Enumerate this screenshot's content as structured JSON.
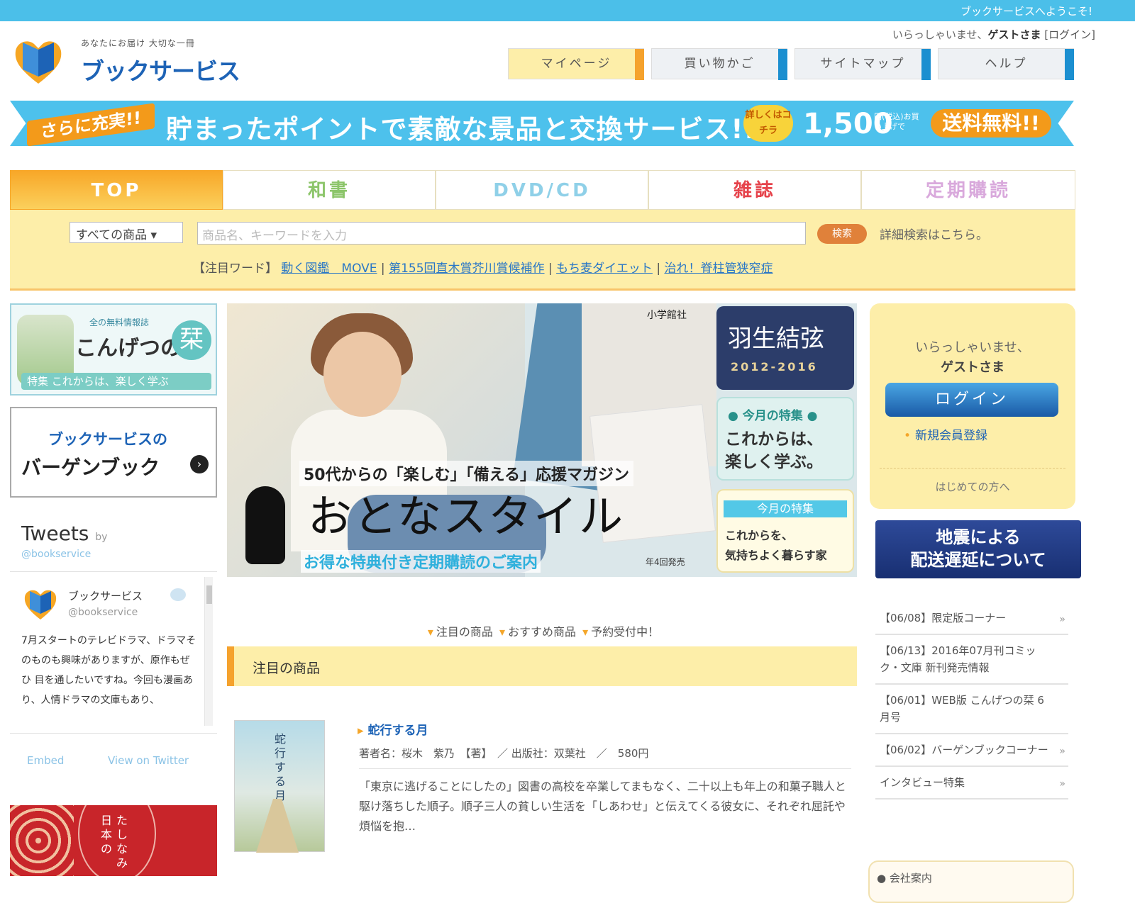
{
  "topbar": {
    "welcome": "ブックサービスへようこそ!"
  },
  "logo": {
    "tagline": "あなたにお届け 大切な一冊",
    "name": "ブックサービス"
  },
  "header": {
    "greeting": "いらっしゃいませ、",
    "guest": "ゲストさま",
    "login_link": "[ログイン]"
  },
  "nav": [
    {
      "label": "マイページ",
      "bg": "#fdeea9",
      "accent": "#f5a22d"
    },
    {
      "label": "買い物かご",
      "bg": "#eef1f4",
      "accent": "#1b8fd0"
    },
    {
      "label": "サイトマップ",
      "bg": "#eef1f4",
      "accent": "#1b8fd0"
    },
    {
      "label": "ヘルプ",
      "bg": "#eef1f4",
      "accent": "#1b8fd0"
    }
  ],
  "banner": {
    "left": "さらに充実!!",
    "main": "貯まったポイントで素敵な景品と交換サービス!!",
    "badge": "詳しくはコチラ",
    "price": "1,500",
    "price_note": "円(税込)お買い上げで",
    "free": "送料無料!!"
  },
  "tabs": [
    {
      "label": "TOP",
      "color": "#ffffff"
    },
    {
      "label": "和書",
      "color": "#8cc56a"
    },
    {
      "label": "DVD/CD",
      "color": "#8fd0e8"
    },
    {
      "label": "雑誌",
      "color": "#e6434b"
    },
    {
      "label": "定期購読",
      "color": "#d9a9dc"
    }
  ],
  "search": {
    "category": "すべての商品",
    "placeholder": "商品名、キーワードを入力",
    "button": "検索",
    "advanced": "詳細検索はこちら。",
    "hot_label": "【注目ワード】",
    "hot_words": [
      "動く図鑑　MOVE",
      "第155回直木賞芥川賞候補作",
      "もち麦ダイエット",
      "治れ！脊柱管狭窄症"
    ]
  },
  "left": {
    "konpan": {
      "top": "全の無料情報誌",
      "name": "こんげつの",
      "char": "栞",
      "strip": "特集 これからは、楽しく学ぶ"
    },
    "bargain": {
      "line1": "ブックサービスの",
      "line2": "バーゲンブック"
    },
    "tweets": {
      "title": "Tweets",
      "by": "by",
      "handle": "@bookservice",
      "user_name": "ブックサービス",
      "user_handle": "@bookservice",
      "text": "7月スタートのテレビドラマ、ドラマそのものも興味がありますが、原作もぜひ 目を通したいですね。今回も漫画あり、人情ドラマの文庫もあり、",
      "embed": "Embed",
      "view": "View on Twitter"
    },
    "red": {
      "col1": "日本の",
      "col2": "たしなみ"
    }
  },
  "hero": {
    "publisher": "小学館社",
    "tagline": "50代からの「楽しむ」「備える」応援マガジン",
    "title": "おとなスタイル",
    "cta": "お得な特典付き定期購読のご案内",
    "cta_small": "年4回発売",
    "panel1_name": "羽生結弦",
    "panel1_years": "2012-2016",
    "panel2_head": "● 今月の特集 ●",
    "panel2_line1": "これからは、",
    "panel2_line2": "楽しく学ぶ。",
    "panel3_head": "今月の特集",
    "panel3_line1": "これからを、",
    "panel3_line2": "気持ちよく暮らす家"
  },
  "subnav": [
    "注目の商品",
    "おすすめ商品",
    "予約受付中！"
  ],
  "section_title": "注目の商品",
  "product": {
    "cover_title": "蛇行する月",
    "title": "蛇行する月",
    "meta": "著者名：桜木　紫乃　【著】　／ 出版社：双葉社　／　580円",
    "desc": "「東京に逃げることにしたの」図書の高校を卒業してまもなく、二十以上も年上の和菓子職人と駆け落ちした順子。順子三人の貧しい生活を「しあわせ」と伝えてくる彼女に、それぞれ屈託や煩悩を抱…"
  },
  "loginbox": {
    "greeting": "いらっしゃいませ、",
    "guest": "ゲストさま",
    "login": "ログイン",
    "register": "新規会員登録",
    "first_time": "はじめての方へ"
  },
  "quake": {
    "line1": "地震による",
    "line2": "配送遅延について"
  },
  "news": [
    {
      "text": "【06/08】限定版コーナー",
      "arrow": "»"
    },
    {
      "text": "【06/13】2016年07月刊コミック・文庫 新刊発売情報",
      "arrow": ""
    },
    {
      "text": "【06/01】WEB版 こんげつの栞 6月号",
      "arrow": ""
    },
    {
      "text": "【06/02】バーゲンブックコーナー",
      "arrow": "»"
    },
    {
      "text": "インタビュー特集",
      "arrow": "»"
    }
  ],
  "company": {
    "label": "● 会社案内"
  }
}
